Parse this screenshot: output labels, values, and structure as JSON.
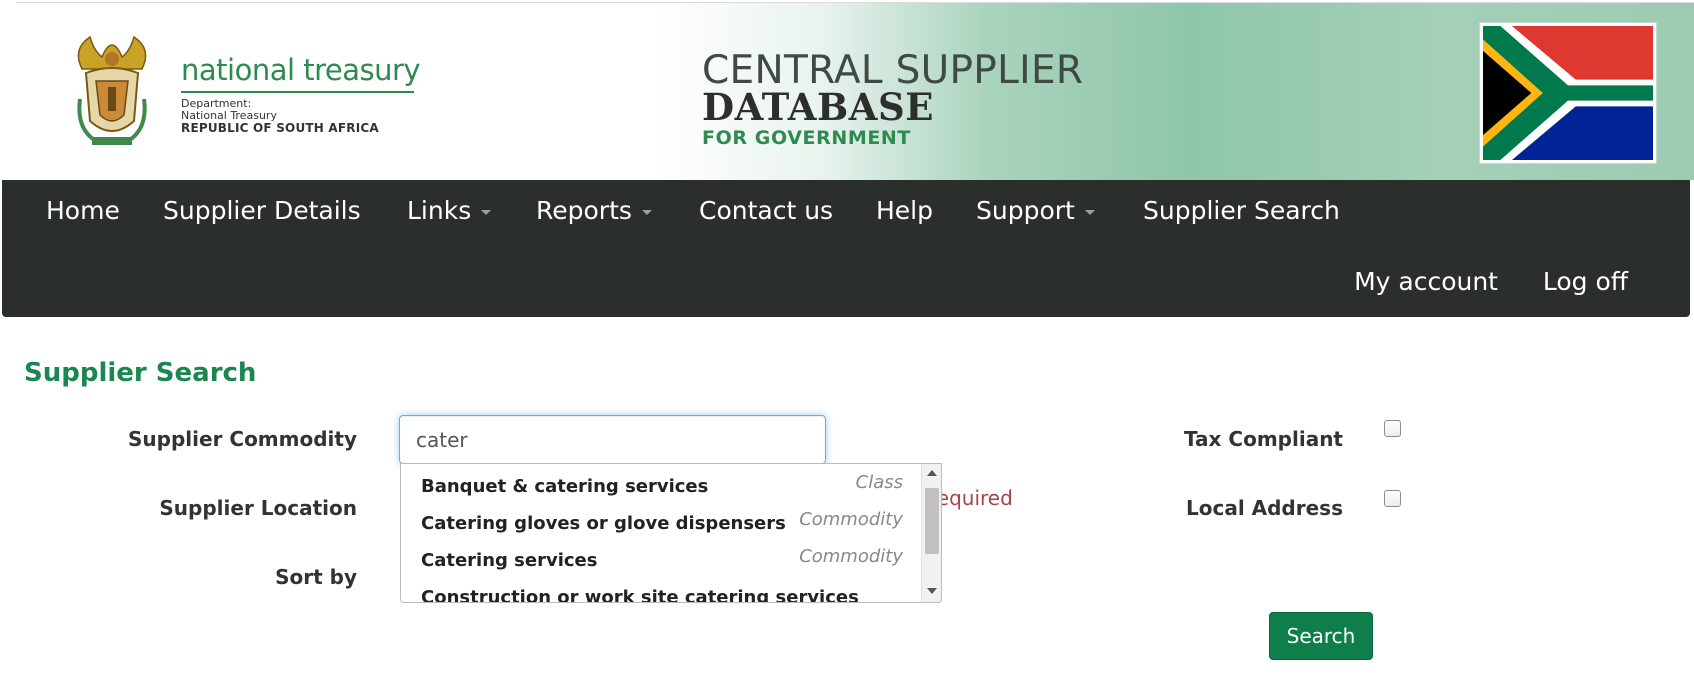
{
  "banner": {
    "treasury_name": "national treasury",
    "treasury_dept_line1": "Department:",
    "treasury_dept_line2": "National Treasury",
    "treasury_dept_line3": "REPUBLIC OF SOUTH AFRICA",
    "csd_line1": "CENTRAL SUPPLIER",
    "csd_line2": "DATABASE",
    "csd_line3": "FOR GOVERNMENT"
  },
  "nav": {
    "items": [
      {
        "label": "Home",
        "dropdown": false
      },
      {
        "label": "Supplier Details",
        "dropdown": false
      },
      {
        "label": "Links",
        "dropdown": true
      },
      {
        "label": "Reports",
        "dropdown": true
      },
      {
        "label": "Contact us",
        "dropdown": false
      },
      {
        "label": "Help",
        "dropdown": false
      },
      {
        "label": "Support",
        "dropdown": true
      },
      {
        "label": "Supplier Search",
        "dropdown": false
      }
    ],
    "my_account": "My account",
    "log_off": "Log off"
  },
  "page": {
    "title": "Supplier Search"
  },
  "form": {
    "commodity_label": "Supplier Commodity",
    "commodity_value": "cater",
    "location_label": "Supplier Location",
    "sort_label": "Sort by",
    "required_message": "required",
    "tax_label": "Tax Compliant",
    "local_label": "Local Address",
    "search_button": "Search"
  },
  "autocomplete": {
    "items": [
      {
        "name": "Banquet & catering services",
        "type": "Class"
      },
      {
        "name": "Catering gloves or glove dispensers",
        "type": "Commodity"
      },
      {
        "name": "Catering services",
        "type": "Commodity"
      },
      {
        "name": "Construction or work site catering services",
        "type": ""
      }
    ]
  },
  "colors": {
    "accent_green": "#1a8650",
    "navbar_bg": "#2b2f2c",
    "button_green": "#0e7e4a",
    "error_red": "#a94442"
  }
}
